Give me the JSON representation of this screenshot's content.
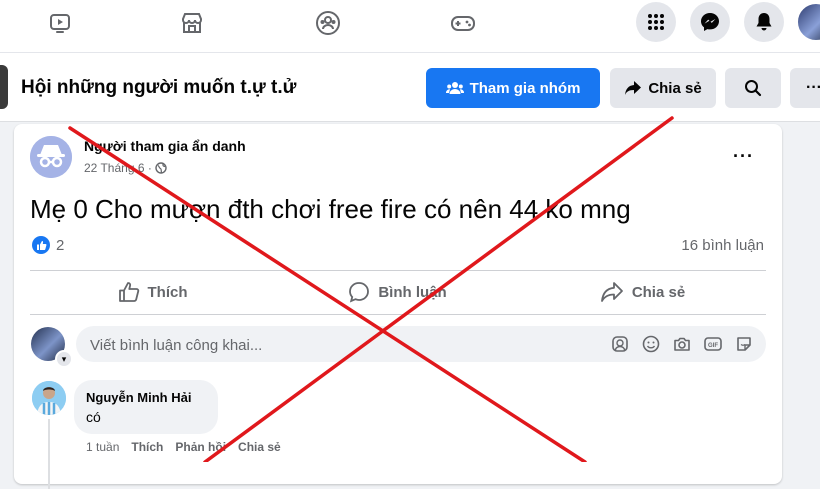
{
  "top_nav": {
    "icons": [
      "video-icon",
      "marketplace-icon",
      "groups-icon",
      "gaming-icon"
    ],
    "right_icons": [
      "menu-grid-icon",
      "messenger-icon",
      "notifications-icon"
    ]
  },
  "group": {
    "title": "Hội những người muốn t.ự t.ử",
    "join_label": "Tham gia nhóm",
    "share_label": "Chia sẻ"
  },
  "post": {
    "author": "Người tham gia ẩn danh",
    "date": "22 Tháng 6 ·",
    "text": "Mẹ 0 Cho mượn đth chơi free fire có nên 44 ko mng",
    "reactions": "2",
    "comments_count": "16 bình luận",
    "actions": {
      "like": "Thích",
      "comment": "Bình luận",
      "share": "Chia sẻ"
    }
  },
  "comment_box": {
    "placeholder": "Viết bình luận công khai..."
  },
  "comment": {
    "author": "Nguyễn Minh Hải",
    "text": "có",
    "time": "1 tuần",
    "like": "Thích",
    "reply": "Phản hồi",
    "share": "Chia sẻ"
  },
  "colors": {
    "accent": "#1877f2",
    "cross": "#e0181c",
    "secondary_text": "#65676b"
  }
}
